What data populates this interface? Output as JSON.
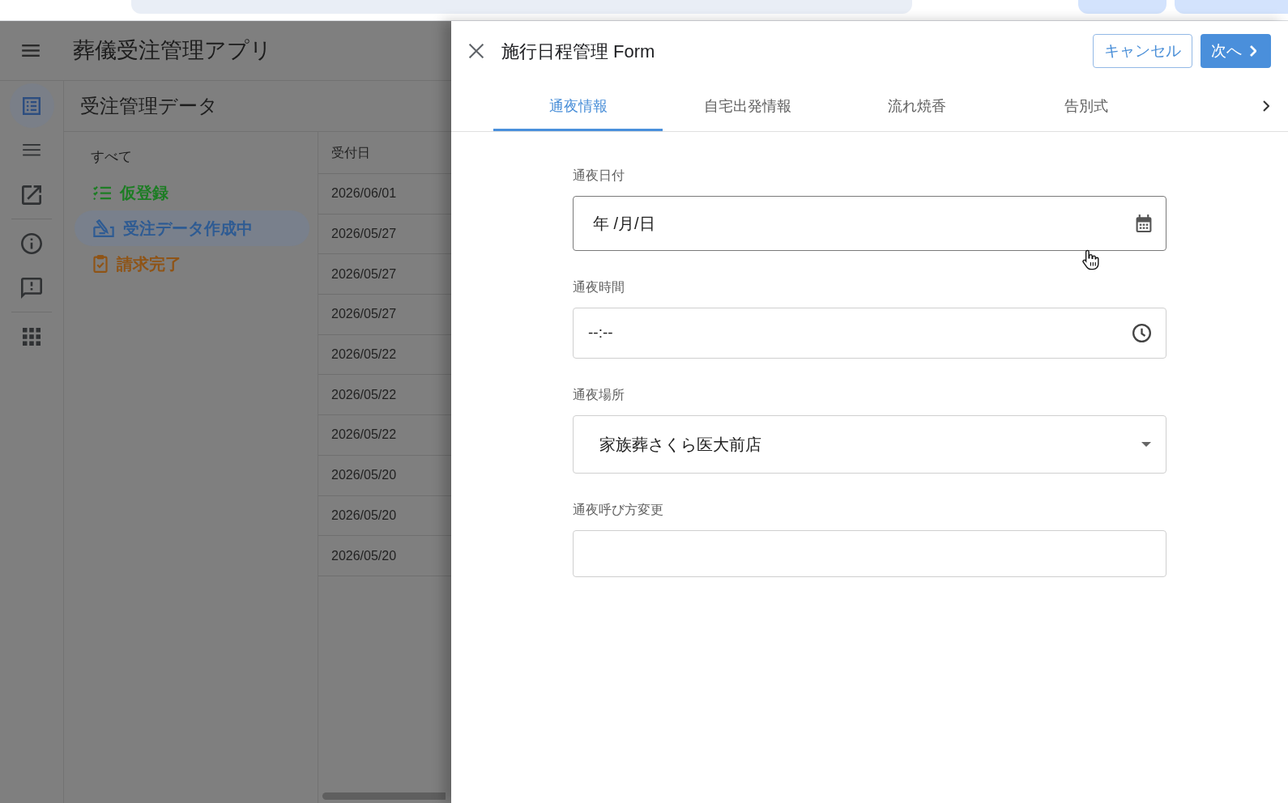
{
  "app": {
    "title": "葬儀受注管理アプリ",
    "rail": [
      {
        "items": [
          {
            "kind": "table",
            "selected": true
          },
          {
            "kind": "list",
            "selected": false
          },
          {
            "kind": "external",
            "selected": false
          }
        ]
      },
      {
        "items": [
          {
            "kind": "info",
            "selected": false
          },
          {
            "kind": "feedback",
            "selected": false
          }
        ]
      },
      {
        "items": [
          {
            "kind": "apps",
            "selected": false
          }
        ]
      }
    ],
    "view_title": "受注管理データ",
    "filters": [
      {
        "label": "すべて",
        "kind": "plain",
        "color": "#1f1f1f",
        "selected": false
      },
      {
        "label": "仮登録",
        "kind": "checklist",
        "color": "#1d7d24",
        "selected": false
      },
      {
        "label": "受注データ作成中",
        "kind": "signing",
        "color": "#2e5b93",
        "selected": true
      },
      {
        "label": "請求完了",
        "kind": "clipboard",
        "color": "#8f5416",
        "selected": false
      }
    ],
    "table": {
      "columns": [
        "受付日"
      ],
      "rows": [
        [
          "2026/06/01"
        ],
        [
          "2026/05/27"
        ],
        [
          "2026/05/27"
        ],
        [
          "2026/05/27"
        ],
        [
          "2026/05/22"
        ],
        [
          "2026/05/22"
        ],
        [
          "2026/05/22"
        ],
        [
          "2026/05/20"
        ],
        [
          "2026/05/20"
        ],
        [
          "2026/05/20"
        ]
      ]
    }
  },
  "form": {
    "title": "施行日程管理 Form",
    "buttons": [
      {
        "label": "キャンセル",
        "kind": "outline"
      },
      {
        "label": "次へ",
        "kind": "primary"
      }
    ],
    "tabs": [
      {
        "label": "通夜情報",
        "selected": true
      },
      {
        "label": "自宅出発情報",
        "selected": false
      },
      {
        "label": "流れ焼香",
        "selected": false
      },
      {
        "label": "告別式",
        "selected": false
      }
    ],
    "fields": [
      {
        "label": "通夜日付",
        "kind": "date",
        "placeholder": "年 /月/日",
        "hovered": true
      },
      {
        "label": "通夜時間",
        "kind": "time",
        "placeholder": "--:--",
        "hovered": false
      },
      {
        "label": "通夜場所",
        "kind": "select",
        "value": "家族葬さくら医大前店",
        "hovered": false
      },
      {
        "label": "通夜呼び方変更",
        "kind": "text",
        "hovered": false
      }
    ]
  }
}
